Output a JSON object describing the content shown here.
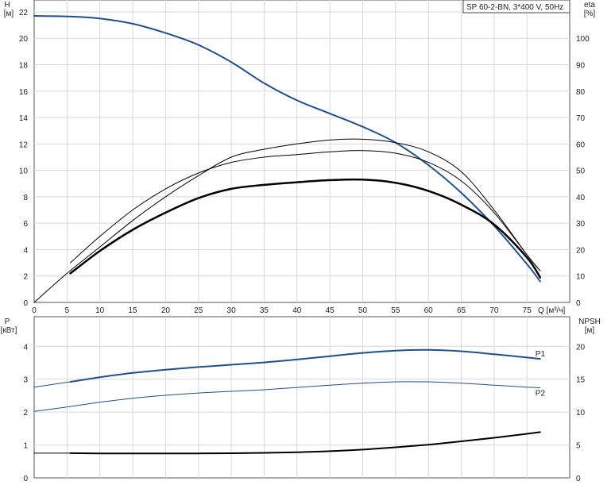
{
  "chart_data": [
    {
      "type": "line",
      "title_box": "SP 60-2-BN, 3*400 V, 50Hz",
      "left_axis": {
        "label": "H",
        "unit": "[м]",
        "ticks": [
          0,
          2,
          4,
          6,
          8,
          10,
          12,
          14,
          16,
          18,
          20,
          22
        ],
        "range": [
          0,
          22.9
        ]
      },
      "right_axis": {
        "label": "eta",
        "unit": "[%]",
        "ticks": [
          0,
          10,
          20,
          30,
          40,
          50,
          60,
          70,
          80,
          90,
          100
        ],
        "range": [
          0,
          114.5
        ]
      },
      "x_axis": {
        "label": "Q [м³/ч]",
        "ticks": [
          0,
          5,
          10,
          15,
          20,
          25,
          30,
          35,
          40,
          45,
          50,
          55,
          60,
          65,
          70,
          75
        ],
        "range": [
          0,
          81.5
        ]
      },
      "grid": true,
      "series": [
        {
          "axis": "left",
          "color": "#1f4f8f",
          "width": 2,
          "x": [
            0,
            5.5,
            10,
            15,
            20,
            25,
            30,
            35,
            40,
            45,
            50,
            55,
            60,
            65,
            70,
            75,
            77
          ],
          "y": [
            21.7,
            21.65,
            21.5,
            21.1,
            20.4,
            19.5,
            18.2,
            16.6,
            15.3,
            14.3,
            13.3,
            12.1,
            10.4,
            8.3,
            5.8,
            2.9,
            1.6
          ]
        },
        {
          "axis": "right",
          "color": "#000000",
          "width": 1,
          "x": [
            0,
            5,
            10,
            15,
            20,
            25,
            30,
            35,
            40,
            45,
            50,
            55,
            60,
            65,
            70,
            75,
            77
          ],
          "y": [
            0,
            11,
            21,
            31,
            40,
            48,
            55,
            58,
            60,
            61.5,
            61.8,
            60.5,
            57,
            49.5,
            35,
            18,
            12
          ]
        },
        {
          "axis": "right",
          "color": "#000000",
          "width": 1,
          "x": [
            5.5,
            10,
            15,
            20,
            25,
            30,
            35,
            40,
            45,
            50,
            55,
            60,
            65,
            70,
            75,
            77
          ],
          "y": [
            15,
            25,
            35,
            43,
            49,
            53,
            55,
            56,
            57,
            57.5,
            56.5,
            53,
            46,
            34,
            18,
            12
          ]
        },
        {
          "axis": "right",
          "color": "#000000",
          "width": 2.5,
          "x": [
            5.5,
            10,
            15,
            20,
            25,
            30,
            35,
            40,
            45,
            50,
            55,
            60,
            65,
            70,
            75,
            77
          ],
          "y": [
            11,
            19.5,
            27.5,
            34,
            39.5,
            43,
            44.5,
            45.5,
            46.3,
            46.5,
            45.3,
            42.2,
            37,
            29.5,
            17,
            9.5
          ]
        }
      ]
    },
    {
      "type": "line",
      "left_axis": {
        "label": "P",
        "unit": "[кВт]",
        "ticks": [
          0,
          1,
          2,
          3,
          4
        ],
        "range": [
          0,
          4.9
        ]
      },
      "right_axis": {
        "label": "NPSH",
        "unit": "[м]",
        "ticks": [
          0,
          5,
          10,
          15,
          20
        ],
        "range": [
          0,
          24.5
        ]
      },
      "x_axis": {
        "range": [
          0,
          81.5
        ]
      },
      "grid": true,
      "series": [
        {
          "name": "P1",
          "axis": "left",
          "color": "#1f4f8f",
          "width": 2,
          "x": [
            5.5,
            10,
            15,
            20,
            25,
            30,
            35,
            40,
            45,
            50,
            55,
            60,
            65,
            70,
            75,
            77
          ],
          "y": [
            2.92,
            3.06,
            3.19,
            3.29,
            3.37,
            3.44,
            3.51,
            3.6,
            3.7,
            3.8,
            3.87,
            3.89,
            3.85,
            3.76,
            3.66,
            3.62
          ]
        },
        {
          "axis": "left",
          "color": "#1f4f8f",
          "width": 1,
          "x": [
            0,
            5.5
          ],
          "y": [
            2.76,
            2.92
          ]
        },
        {
          "name": "P2",
          "axis": "left",
          "color": "#1f4f8f",
          "width": 1,
          "x": [
            0,
            5.5,
            10,
            15,
            20,
            25,
            30,
            35,
            40,
            45,
            50,
            55,
            60,
            65,
            70,
            75,
            77
          ],
          "y": [
            2.02,
            2.17,
            2.3,
            2.42,
            2.51,
            2.58,
            2.63,
            2.68,
            2.75,
            2.82,
            2.88,
            2.92,
            2.92,
            2.88,
            2.82,
            2.76,
            2.74
          ]
        },
        {
          "axis": "right",
          "color": "#000000",
          "width": 2,
          "x": [
            5.5,
            10,
            15,
            20,
            25,
            30,
            35,
            40,
            45,
            50,
            55,
            60,
            65,
            70,
            75,
            77
          ],
          "y": [
            3.75,
            3.72,
            3.72,
            3.72,
            3.72,
            3.74,
            3.8,
            3.9,
            4.05,
            4.3,
            4.65,
            5.05,
            5.55,
            6.1,
            6.7,
            6.95
          ]
        },
        {
          "axis": "right",
          "color": "#000000",
          "width": 1,
          "x": [
            0,
            5.5
          ],
          "y": [
            3.75,
            3.75
          ]
        }
      ]
    }
  ]
}
